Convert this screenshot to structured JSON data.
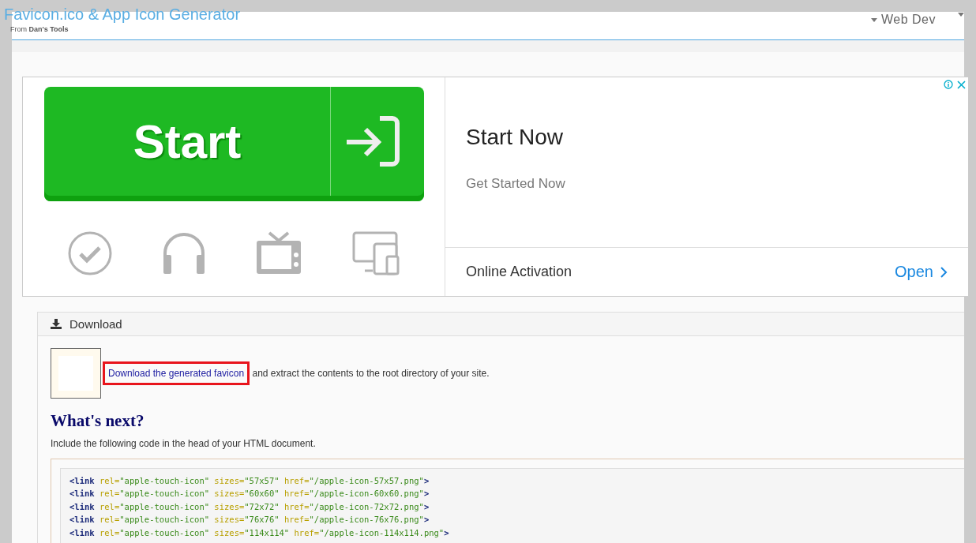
{
  "header": {
    "title": "Favicon.ico & App Icon Generator",
    "subtitle_prefix": "From",
    "subtitle_name": "Dan's Tools",
    "menus": [
      {
        "kind": "labeled",
        "label": "Web Dev"
      },
      {
        "kind": "cut"
      }
    ]
  },
  "ad": {
    "button_label": "Start",
    "headline": "Start Now",
    "subline": "Get Started Now",
    "action_label": "Online Activation",
    "action_link": "Open"
  },
  "download": {
    "heading": "Download",
    "link_text": "Download the generated favicon",
    "link_highlighted": true,
    "rest_text": "and extract the contents to the root directory of your site.",
    "next_heading": "What's next?",
    "intro": "Include the following code in the head of your HTML document.",
    "code_lines": [
      {
        "open": "<link",
        "attrs": [
          {
            "name": "rel=",
            "value": "\"apple-touch-icon\""
          },
          {
            "name": "sizes=",
            "value": "\"57x57\""
          },
          {
            "name": "href=",
            "value": "\"/apple-icon-57x57.png\""
          }
        ],
        "close": ">"
      },
      {
        "open": "<link",
        "attrs": [
          {
            "name": "rel=",
            "value": "\"apple-touch-icon\""
          },
          {
            "name": "sizes=",
            "value": "\"60x60\""
          },
          {
            "name": "href=",
            "value": "\"/apple-icon-60x60.png\""
          }
        ],
        "close": ">"
      },
      {
        "open": "<link",
        "attrs": [
          {
            "name": "rel=",
            "value": "\"apple-touch-icon\""
          },
          {
            "name": "sizes=",
            "value": "\"72x72\""
          },
          {
            "name": "href=",
            "value": "\"/apple-icon-72x72.png\""
          }
        ],
        "close": ">"
      },
      {
        "open": "<link",
        "attrs": [
          {
            "name": "rel=",
            "value": "\"apple-touch-icon\""
          },
          {
            "name": "sizes=",
            "value": "\"76x76\""
          },
          {
            "name": "href=",
            "value": "\"/apple-icon-76x76.png\""
          }
        ],
        "close": ">"
      },
      {
        "open": "<link",
        "attrs": [
          {
            "name": "rel=",
            "value": "\"apple-touch-icon\""
          },
          {
            "name": "sizes=",
            "value": "\"114x114\""
          },
          {
            "name": "href=",
            "value": "\"/apple-icon-114x114.png\""
          }
        ],
        "close": ">"
      }
    ]
  }
}
